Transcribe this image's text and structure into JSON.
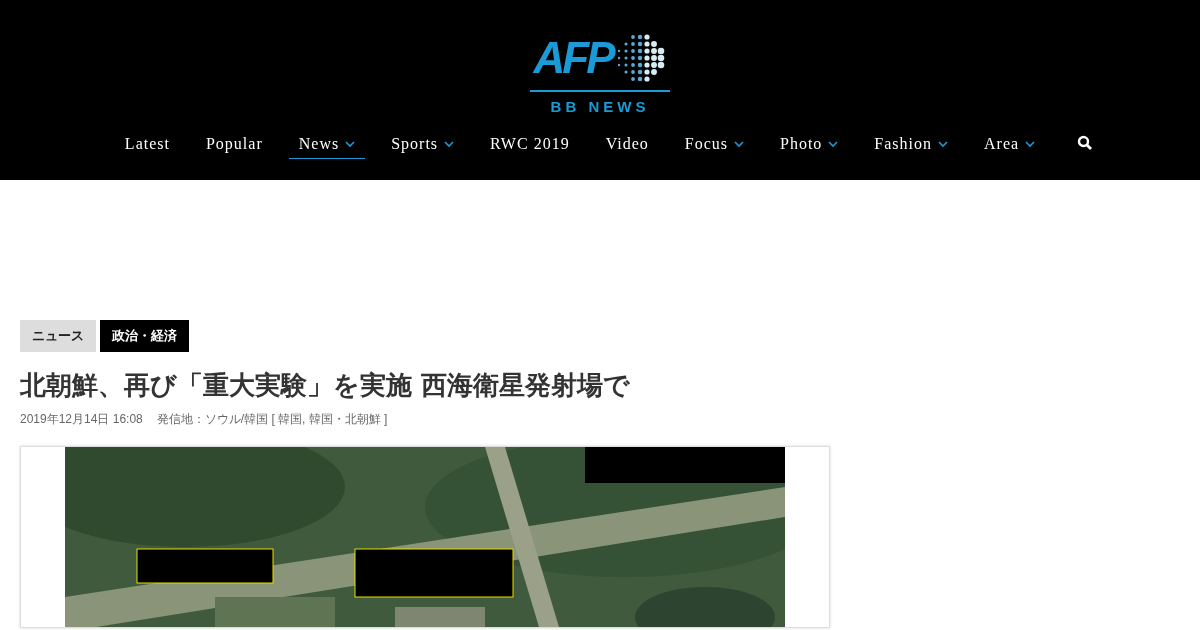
{
  "logo": {
    "mark": "AFP",
    "subtitle": "BB NEWS"
  },
  "nav": [
    {
      "label": "Latest",
      "dropdown": false,
      "selected": false
    },
    {
      "label": "Popular",
      "dropdown": false,
      "selected": false
    },
    {
      "label": "News",
      "dropdown": true,
      "selected": true
    },
    {
      "label": "Sports",
      "dropdown": true,
      "selected": false
    },
    {
      "label": "RWC 2019",
      "dropdown": false,
      "selected": false
    },
    {
      "label": "Video",
      "dropdown": false,
      "selected": false
    },
    {
      "label": "Focus",
      "dropdown": true,
      "selected": false
    },
    {
      "label": "Photo",
      "dropdown": true,
      "selected": false
    },
    {
      "label": "Fashion",
      "dropdown": true,
      "selected": false
    },
    {
      "label": "Area",
      "dropdown": true,
      "selected": false
    }
  ],
  "categories": [
    {
      "label": "ニュース",
      "selected": false
    },
    {
      "label": "政治・経済",
      "selected": true
    }
  ],
  "article": {
    "title": "北朝鮮、再び「重大実験」を実施 西海衛星発射場で",
    "date": "2019年12月14日 16:08",
    "location": "発信地：ソウル/韓国 [ 韓国, 韓国・北朝鮮 ]"
  }
}
